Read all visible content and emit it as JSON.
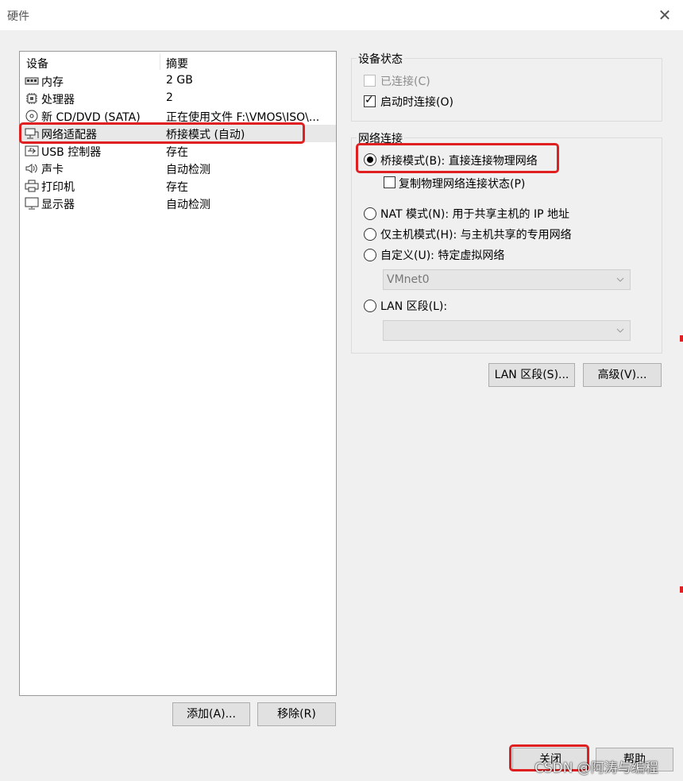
{
  "window": {
    "title": "硬件"
  },
  "list": {
    "col_device": "设备",
    "col_summary": "摘要",
    "items": [
      {
        "name": "内存",
        "summary": "2 GB",
        "icon": "memory-icon"
      },
      {
        "name": "处理器",
        "summary": "2",
        "icon": "cpu-icon"
      },
      {
        "name": "新 CD/DVD (SATA)",
        "summary": "正在使用文件 F:\\VMOS\\ISO\\...",
        "icon": "cd-dvd-icon"
      },
      {
        "name": "网络适配器",
        "summary": "桥接模式 (自动)",
        "icon": "network-adapter-icon",
        "selected": true
      },
      {
        "name": "USB 控制器",
        "summary": "存在",
        "icon": "usb-icon"
      },
      {
        "name": "声卡",
        "summary": "自动检测",
        "icon": "speaker-icon"
      },
      {
        "name": "打印机",
        "summary": "存在",
        "icon": "printer-icon"
      },
      {
        "name": "显示器",
        "summary": "自动检测",
        "icon": "monitor-icon"
      }
    ]
  },
  "buttons": {
    "add": "添加(A)...",
    "remove": "移除(R)",
    "lan_segments": "LAN 区段(S)...",
    "advanced": "高级(V)...",
    "close": "关闭",
    "help": "帮助"
  },
  "device_status": {
    "title": "设备状态",
    "connected": {
      "label": "已连接(C)",
      "checked": false,
      "disabled": true
    },
    "connect_at_power_on": {
      "label": "启动时连接(O)",
      "checked": true
    }
  },
  "network_connection": {
    "title": "网络连接",
    "bridged": {
      "label": "桥接模式(B): 直接连接物理网络",
      "selected": true
    },
    "replicate": {
      "label": "复制物理网络连接状态(P)",
      "checked": false
    },
    "nat": {
      "label": "NAT 模式(N): 用于共享主机的 IP 地址",
      "selected": false
    },
    "host_only": {
      "label": "仅主机模式(H): 与主机共享的专用网络",
      "selected": false
    },
    "custom": {
      "label": "自定义(U): 特定虚拟网络",
      "selected": false
    },
    "custom_network": "VMnet0",
    "lan_segment": {
      "label": "LAN 区段(L):",
      "selected": false
    },
    "lan_segment_value": ""
  },
  "watermark": "CSDN @阿涛与编程",
  "colors": {
    "highlight_box": "#e02020",
    "selected_row": "#e8e8e8"
  }
}
